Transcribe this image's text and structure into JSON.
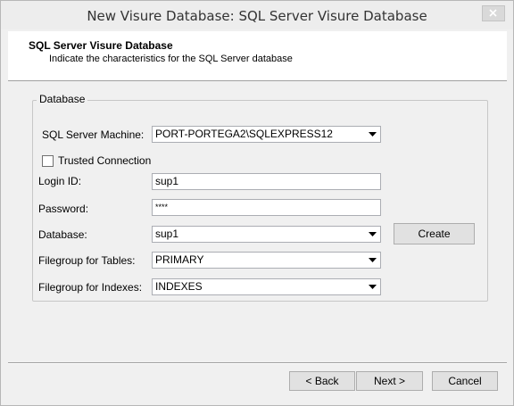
{
  "window": {
    "title": "New Visure Database: SQL Server Visure Database"
  },
  "header": {
    "title": "SQL Server Visure Database",
    "subtitle": "Indicate the characteristics for the SQL Server database"
  },
  "group": {
    "legend": "Database"
  },
  "form": {
    "server_machine": {
      "label": "SQL Server Machine:",
      "value": "PORT-PORTEGA2\\SQLEXPRESS12"
    },
    "trusted_connection": {
      "label": "Trusted Connection",
      "checked": false
    },
    "login_id": {
      "label": "Login ID:",
      "value": "sup1"
    },
    "password": {
      "label": "Password:",
      "value": "****"
    },
    "database": {
      "label": "Database:",
      "value": "sup1"
    },
    "filegroup_tables": {
      "label": "Filegroup for Tables:",
      "value": "PRIMARY"
    },
    "filegroup_indexes": {
      "label": "Filegroup for Indexes:",
      "value": "INDEXES"
    }
  },
  "buttons": {
    "create": "Create",
    "back": "< Back",
    "next": "Next >",
    "cancel": "Cancel"
  },
  "icons": {
    "close": "close-icon",
    "dropdown": "chevron-down-icon"
  }
}
